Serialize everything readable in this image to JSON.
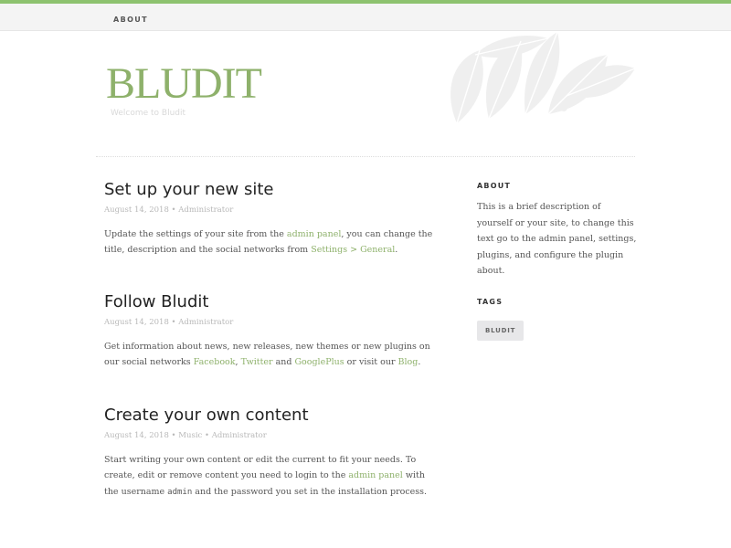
{
  "nav": {
    "about_label": "ABOUT"
  },
  "header": {
    "title": "BLUDIT",
    "tagline": "Welcome to Bludit"
  },
  "colors": {
    "accent": "#8eb16b",
    "top_line": "#8dc26f"
  },
  "posts": [
    {
      "title": "Set up your new site",
      "meta": "August 14, 2018 • Administrator",
      "body": {
        "t1": "Update the settings of your site from the ",
        "link1": "admin panel",
        "t2": ", you can change the title, description and the social networks from ",
        "link2": "Settings > General",
        "t3": "."
      }
    },
    {
      "title": "Follow Bludit",
      "meta": "August 14, 2018 • Administrator",
      "body": {
        "t1": "Get information about news, new releases, new themes or new plugins on our social networks ",
        "link1": "Facebook",
        "t2": ", ",
        "link2": "Twitter",
        "t3": " and ",
        "link3": "GooglePlus",
        "t4": " or visit our ",
        "link4": "Blog",
        "t5": "."
      }
    },
    {
      "title": "Create your own content",
      "meta": "August 14, 2018 • Music • Administrator",
      "body": {
        "t1": "Start writing your own content or edit the current to fit your needs. To create, edit or remove content you need to login to the ",
        "link1": "admin panel",
        "t2": " with the username ",
        "code": "admin",
        "t3": " and the password you set in the installation process."
      }
    }
  ],
  "sidebar": {
    "about_heading": "ABOUT",
    "about_text": "This is a brief description of yourself or your site, to change this text go to the admin panel, settings, plugins, and configure the plugin about.",
    "tags_heading": "TAGS",
    "tags": [
      "BLUDIT"
    ]
  }
}
